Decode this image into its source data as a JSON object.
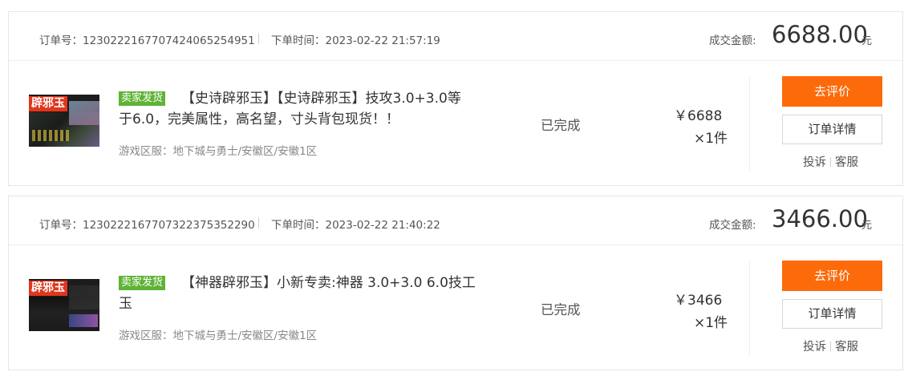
{
  "orders": [
    {
      "order_no_label": "订单号:",
      "order_no": "1230222167707424065254951",
      "order_no_text": "订单号：1230222167707424065254951",
      "order_time_text": "下单时间：2023-02-22 21:57:19",
      "amount_label": "成交金额:",
      "amount": "6688.00",
      "currency_unit": "元",
      "thumb_logo": "辟邪玉",
      "badge": "卖家发货",
      "title_line1": "【史诗辟邪玉】【史诗辟邪玉】技攻3.0+3.0等",
      "title_line2": "于6.0，完美属性，高名望，寸头背包现货！！",
      "region": "游戏区服：地下城与勇士/安徽区/安徽1区",
      "status": "已完成",
      "price": "￥6688",
      "qty": "×1件",
      "review_label": "去评价",
      "detail_label": "订单详情",
      "complain_label": "投诉",
      "service_label": "客服"
    },
    {
      "order_no_text": "订单号：1230222167707322375352290",
      "order_time_text": "下单时间：2023-02-22 21:40:22",
      "amount_label": "成交金额:",
      "amount": "3466.00",
      "currency_unit": "元",
      "thumb_logo": "辟邪玉",
      "badge": "卖家发货",
      "title_line1": "【神器辟邪玉】小新专卖:神器 3.0+3.0 6.0技工",
      "title_line2": "玉",
      "region": "游戏区服：地下城与勇士/安徽区/安徽1区",
      "status": "已完成",
      "price": "￥3466",
      "qty": "×1件",
      "review_label": "去评价",
      "detail_label": "订单详情",
      "complain_label": "投诉",
      "service_label": "客服"
    }
  ],
  "colors": {
    "accent_button": "#fd6a0a",
    "badge": "#5fb336",
    "logo": "#e1361c"
  }
}
